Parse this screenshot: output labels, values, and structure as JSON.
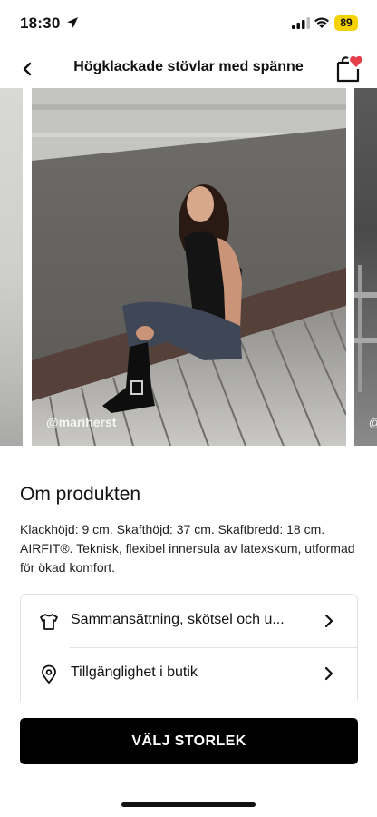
{
  "status_bar": {
    "time": "18:30",
    "battery": "89",
    "icons": [
      "location-arrow-icon",
      "signal-icon",
      "wifi-icon",
      "battery-icon"
    ],
    "battery_color": "#f5d300"
  },
  "header": {
    "title": "Högklackade stövlar med spänne",
    "back_icon": "chevron-left-icon",
    "bag_icon": "shopping-bag-icon",
    "bag_badge_icon": "heart-icon",
    "badge_color": "#e8404a"
  },
  "carousel": {
    "credit": "@mariherst",
    "credit_next": "@"
  },
  "about": {
    "title": "Om produkten",
    "description": "Klackhöjd: 9 cm. Skafthöjd: 37 cm. Skaftbredd: 18 cm. AIRFIT®. Teknisk, flexibel innersula av latexskum, utformad för ökad komfort."
  },
  "info_list": [
    {
      "label": "Sammansättning, skötsel och u...",
      "icon": "tshirt-icon"
    },
    {
      "label": "Tillgänglighet i butik",
      "icon": "location-pin-icon"
    }
  ],
  "cta": {
    "label": "VÄLJ STORLEK",
    "color": "#000000"
  }
}
